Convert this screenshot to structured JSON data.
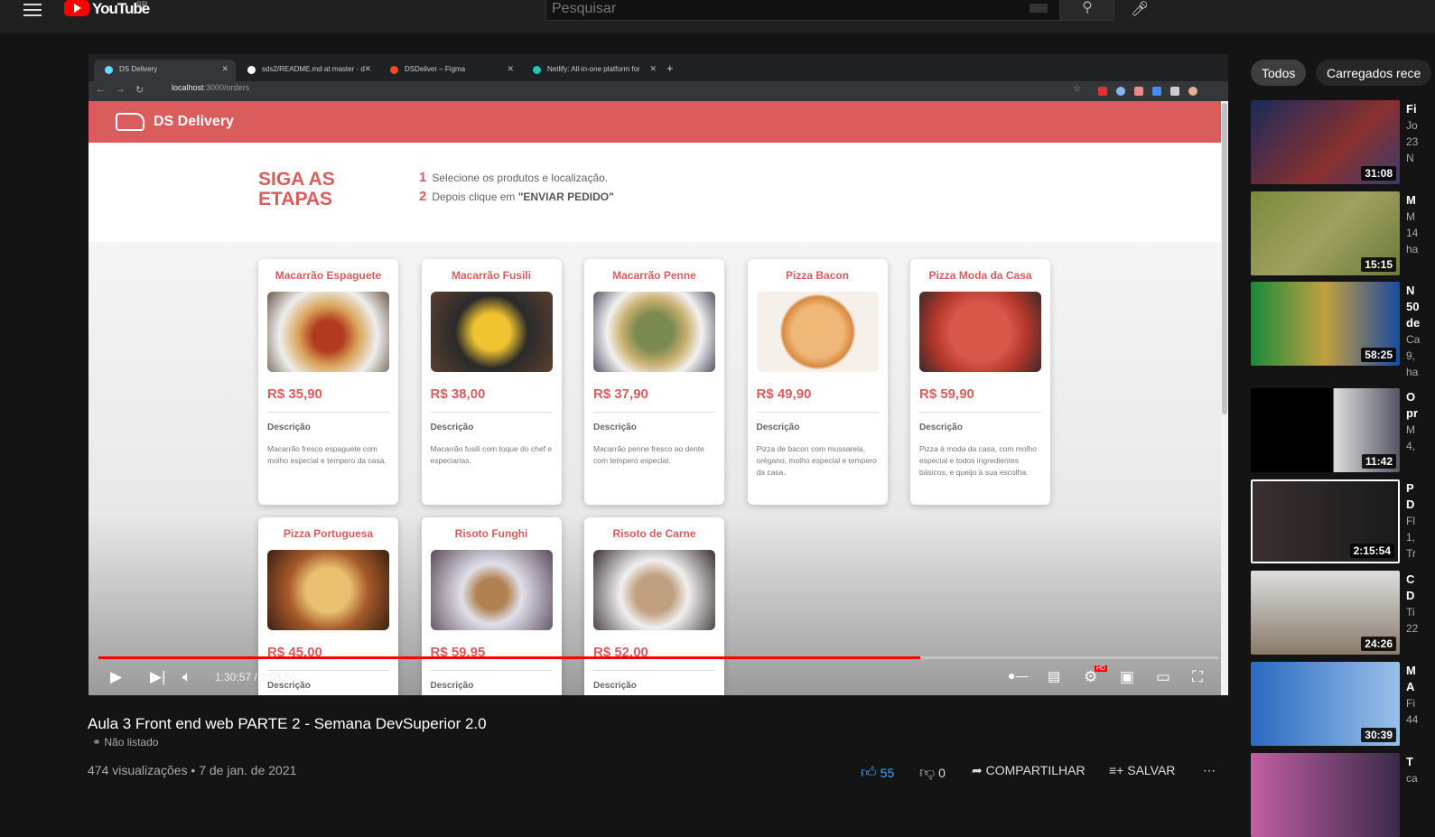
{
  "youtube": {
    "logo": "YouTube",
    "country": "BR",
    "search_placeholder": "Pesquisar"
  },
  "browser": {
    "tabs": [
      {
        "label": "DS Delivery",
        "color": "#61dafb"
      },
      {
        "label": "sds2/README.md at master · d",
        "color": "#ffffff"
      },
      {
        "label": "DSDeliver – Figma",
        "color": "#f24e1e"
      },
      {
        "label": "Netlify: All-in-one platform for",
        "color": "#20c6b7"
      }
    ],
    "url_host": "localhost",
    "url_path": ":3000/orders"
  },
  "app": {
    "title": "DS Delivery",
    "steps_title": "SIGA AS ETAPAS",
    "steps": [
      {
        "n": "1",
        "text": "Selecione os produtos e localização.",
        "bold": ""
      },
      {
        "n": "2",
        "text": "Depois clique em ",
        "bold": "\"ENVIAR PEDIDO\""
      }
    ],
    "desc_label": "Descrição",
    "products": [
      {
        "name": "Macarrão Espaguete",
        "price": "R$ 35,90",
        "desc": "Macarrão fresco espaguete com molho especial e tempero da casa.",
        "img": "radial-gradient(circle at 50% 55%,#b23a1e 20%,#d9a45a 40%,#eee 65%,#6b5a4a)"
      },
      {
        "name": "Macarrão Fusili",
        "price": "R$ 38,00",
        "desc": "Macarrão fusili com toque do chef e especiarias.",
        "img": "radial-gradient(circle at 50% 50%,#f0c330 25%,#2a2a2a 50%,#5a4030)"
      },
      {
        "name": "Macarrão Penne",
        "price": "R$ 37,90",
        "desc": "Macarrão penne fresco ao dente com tempero especial.",
        "img": "radial-gradient(circle at 50% 50%,#7a8a50 25%,#c9b070 45%,#f2f2f2 65%,#556)"
      },
      {
        "name": "Pizza Bacon",
        "price": "R$ 49,90",
        "desc": "Pizza de bacon com mussarela, orégano, molho especial e tempero da casa.",
        "img": "radial-gradient(circle at 50% 50%,#f0b878 35%,#d88a40 48%,#f6f0ea 52%)"
      },
      {
        "name": "Pizza Moda da Casa",
        "price": "R$ 59,90",
        "desc": "Pizza à moda da casa, com molho especial e todos ingredientes básicos, e queijo à sua escolha.",
        "img": "radial-gradient(circle at 50% 50%,#d8584a 40%,#b0362a 65%,#3a2a2a)"
      },
      {
        "name": "Pizza Portuguesa",
        "price": "R$ 45,00",
        "desc": "",
        "img": "radial-gradient(circle at 50% 50%,#e8c070 30%,#a65a2a 55%,#3a2010)"
      },
      {
        "name": "Risoto Funghi",
        "price": "R$ 59,95",
        "desc": "",
        "img": "radial-gradient(circle at 50% 55%,#b08050 20%,#e0e0ea 40%,#5a4a5a)"
      },
      {
        "name": "Risoto de Carne",
        "price": "R$ 52,00",
        "desc": "",
        "img": "radial-gradient(circle at 50% 55%,#c0a080 25%,#f0f0f0 45%,#3a3030)"
      }
    ]
  },
  "player": {
    "current_time": "1:30:57",
    "duration": "2:03:56",
    "progress": 0.734,
    "hd_badge": "HD"
  },
  "video": {
    "title": "Aula 3 Front end web PARTE 2 - Semana DevSuperior 2.0",
    "visibility": "Não listado",
    "views": "474 visualizações",
    "date": "7 de jan. de 2021",
    "likes": "55",
    "dislikes": "0",
    "share": "COMPARTILHAR",
    "save": "SALVAR"
  },
  "sidebar": {
    "chips": [
      "Todos",
      "Carregados rece"
    ],
    "videos": [
      {
        "duration": "31:08",
        "lines": [
          "Fi",
          "Jo",
          "23",
          "N"
        ],
        "bg": "linear-gradient(135deg,#1a2a5a,#8a3030 60%,#3a3a6a)"
      },
      {
        "duration": "15:15",
        "lines": [
          "M",
          "M",
          "14",
          "ha"
        ],
        "bg": "linear-gradient(135deg,#7a8a3a,#a0a060 50%,#6a7a3a)"
      },
      {
        "duration": "58:25",
        "lines": [
          "N",
          "50",
          "de",
          "Ca",
          "9,",
          "ha"
        ],
        "bg": "linear-gradient(90deg,#1a8a3a,#c0a040 50%,#1a4aa0)"
      },
      {
        "duration": "11:42",
        "lines": [
          "O",
          "pr",
          "M",
          "4,"
        ],
        "bg": "linear-gradient(90deg,#000 55%,#ddd 56%,#556)"
      },
      {
        "duration": "2:15:54",
        "lines": [
          "P",
          "D",
          "Fl",
          "1,",
          "Tr"
        ],
        "bg": "linear-gradient(90deg,#3a3030,#1a1a1a)"
      },
      {
        "duration": "24:26",
        "lines": [
          "C",
          "D",
          "Ti",
          "22"
        ],
        "bg": "linear-gradient(180deg,#ddd,#8a7a6a)"
      },
      {
        "duration": "30:39",
        "lines": [
          "M",
          "A",
          "Fi",
          "44"
        ],
        "bg": "linear-gradient(90deg,#2a6ac0,#9ac0e8)"
      },
      {
        "duration": "",
        "lines": [
          "T",
          "ca"
        ],
        "bg": "linear-gradient(90deg,#c060a0,#3a2a4a)"
      }
    ]
  }
}
